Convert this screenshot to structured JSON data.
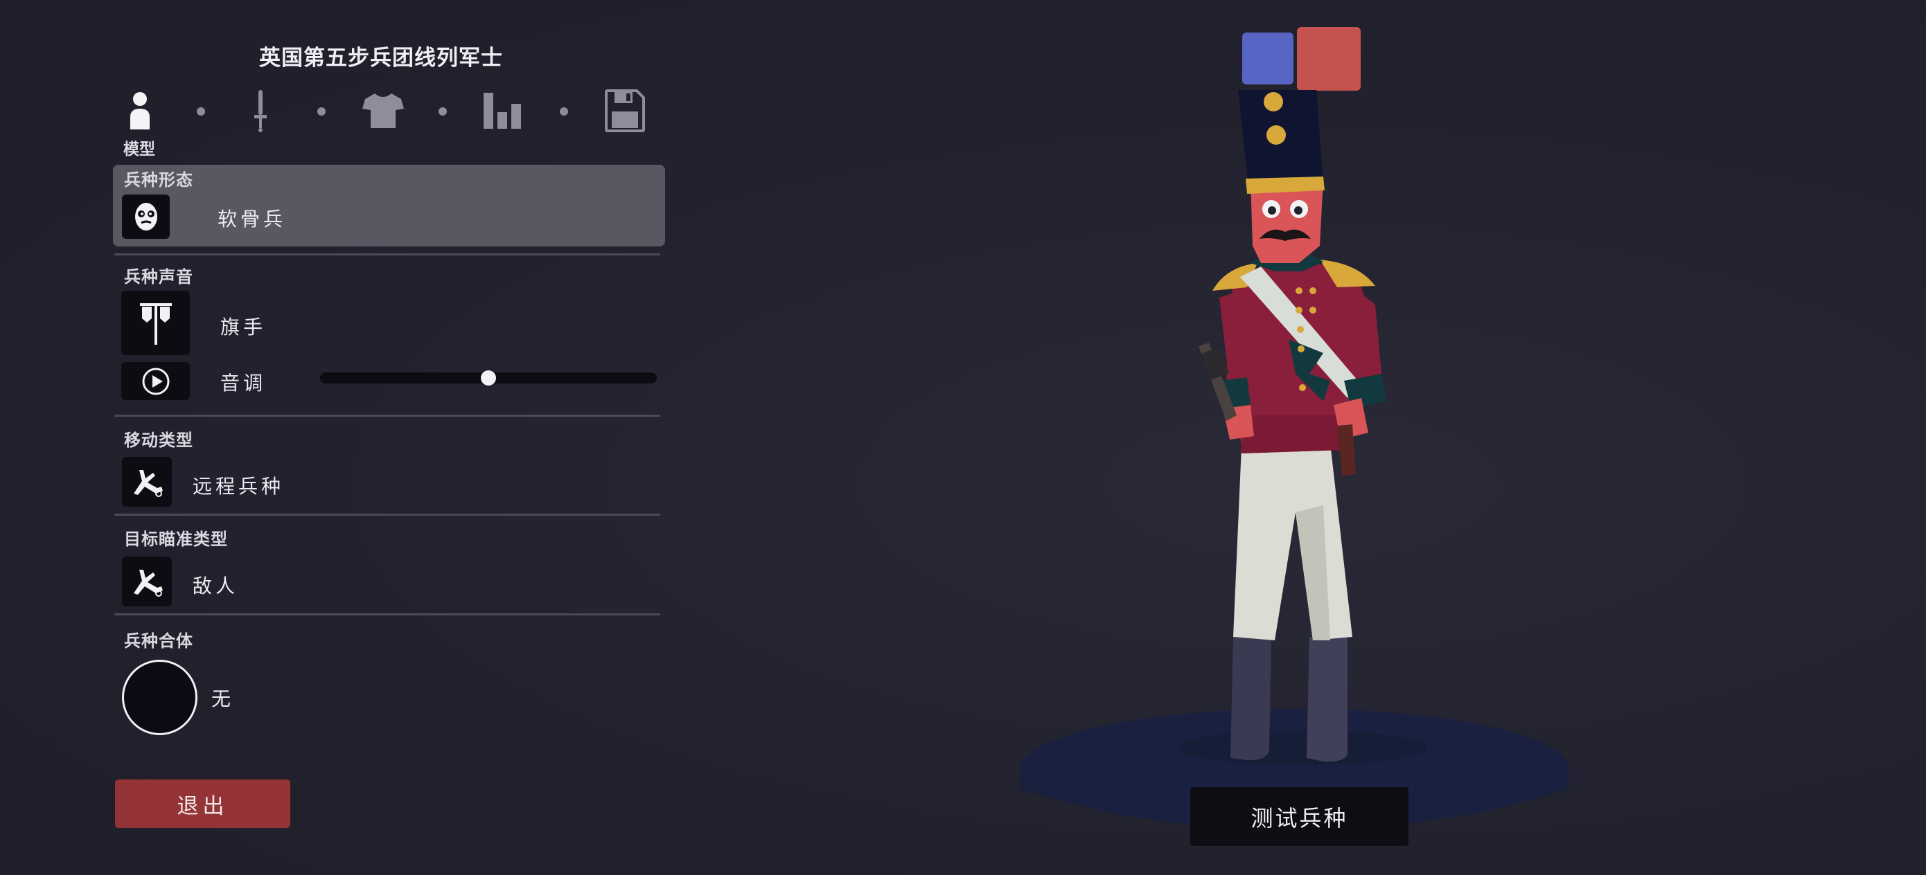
{
  "unit_title": "英国第五步兵团线列军士",
  "steps": {
    "active_label": "模型",
    "icons": [
      "person-icon",
      "sword-icon",
      "shirt-icon",
      "stats-icon",
      "save-icon"
    ]
  },
  "sections": {
    "form": {
      "label": "兵种形态",
      "value": "软骨兵",
      "icon": "mask-face-icon"
    },
    "voice": {
      "label": "兵种声音",
      "value": "旗手",
      "icon": "banner-icon",
      "pitch_label": "音调",
      "pitch_level": 0.5,
      "play_icon": "play-icon"
    },
    "movement": {
      "label": "移动类型",
      "value": "远程兵种",
      "icon": "ranged-unit-icon"
    },
    "targeting": {
      "label": "目标瞄准类型",
      "value": "敌人",
      "icon": "enemy-target-icon"
    },
    "combine": {
      "label": "兵种合体",
      "value": "无"
    }
  },
  "buttons": {
    "exit": "退出",
    "test": "测试兵种"
  },
  "team_colors": {
    "blue": "#5865c4",
    "red": "#c4524f"
  }
}
